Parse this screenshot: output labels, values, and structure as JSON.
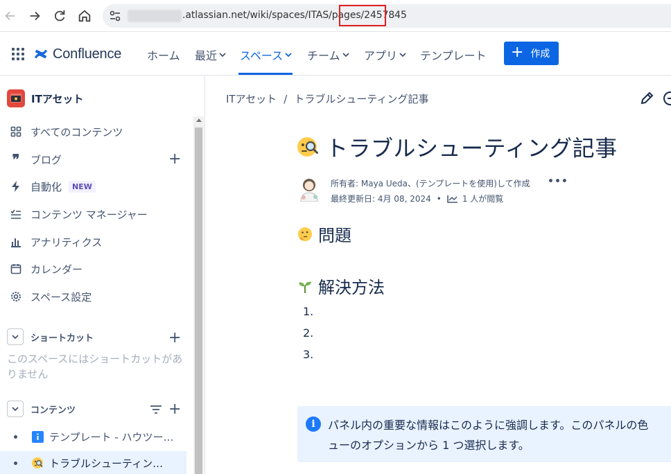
{
  "browser": {
    "url_text": ".atlassian.net/wiki/spaces/ITAS/pages/2457845"
  },
  "topnav": {
    "product": "Confluence",
    "items": [
      {
        "label": "ホーム"
      },
      {
        "label": "最近"
      },
      {
        "label": "スペース"
      },
      {
        "label": "チーム"
      },
      {
        "label": "アプリ"
      },
      {
        "label": "テンプレート"
      }
    ],
    "create_label": "作成"
  },
  "sidebar": {
    "space_name": "ITアセット",
    "items": [
      {
        "label": "すべてのコンテンツ",
        "icon": "grid-icon"
      },
      {
        "label": "ブログ",
        "icon": "quote-icon"
      },
      {
        "label": "自動化",
        "icon": "lightning-icon",
        "badge": "NEW"
      },
      {
        "label": "コンテンツ マネージャー",
        "icon": "list-check-icon"
      },
      {
        "label": "アナリティクス",
        "icon": "bar-chart-icon"
      },
      {
        "label": "カレンダー",
        "icon": "calendar-icon"
      },
      {
        "label": "スペース設定",
        "icon": "gear-icon"
      }
    ],
    "shortcuts_label": "ショートカット",
    "shortcuts_empty": "このスペースにはショートカットがありません",
    "content_label": "コンテンツ",
    "tree": [
      {
        "label": "テンプレート - ハウツー…",
        "icon": "info-icon"
      },
      {
        "label": "トラブルシューティン…",
        "icon": "magnifier-emoji-icon"
      }
    ]
  },
  "page": {
    "breadcrumb": [
      "ITアセット",
      "トラブルシューティング記事"
    ],
    "breadcrumb_sep": "/",
    "title": "トラブルシューティング記事",
    "byline_owner": "所有者: Maya Ueda、(テンプレートを使用)して作成",
    "byline_more": "•••",
    "last_updated": "最終更新日: 4月 08, 2024",
    "bullet": "•",
    "views": "1 人が閲覧",
    "section1": "問題",
    "section2": "解決方法",
    "list": [
      "1.",
      "2.",
      "3."
    ],
    "panel_line1": "パネル内の重要な情報はこのように強調します。このパネルの色",
    "panel_line2": "ューのオプションから 1 つ選択します。"
  },
  "colors": {
    "accent": "#0c66e4",
    "space_icon": "#e2483d",
    "panel_bg": "#e9f2ff",
    "url_highlight": "#e01e1e"
  }
}
